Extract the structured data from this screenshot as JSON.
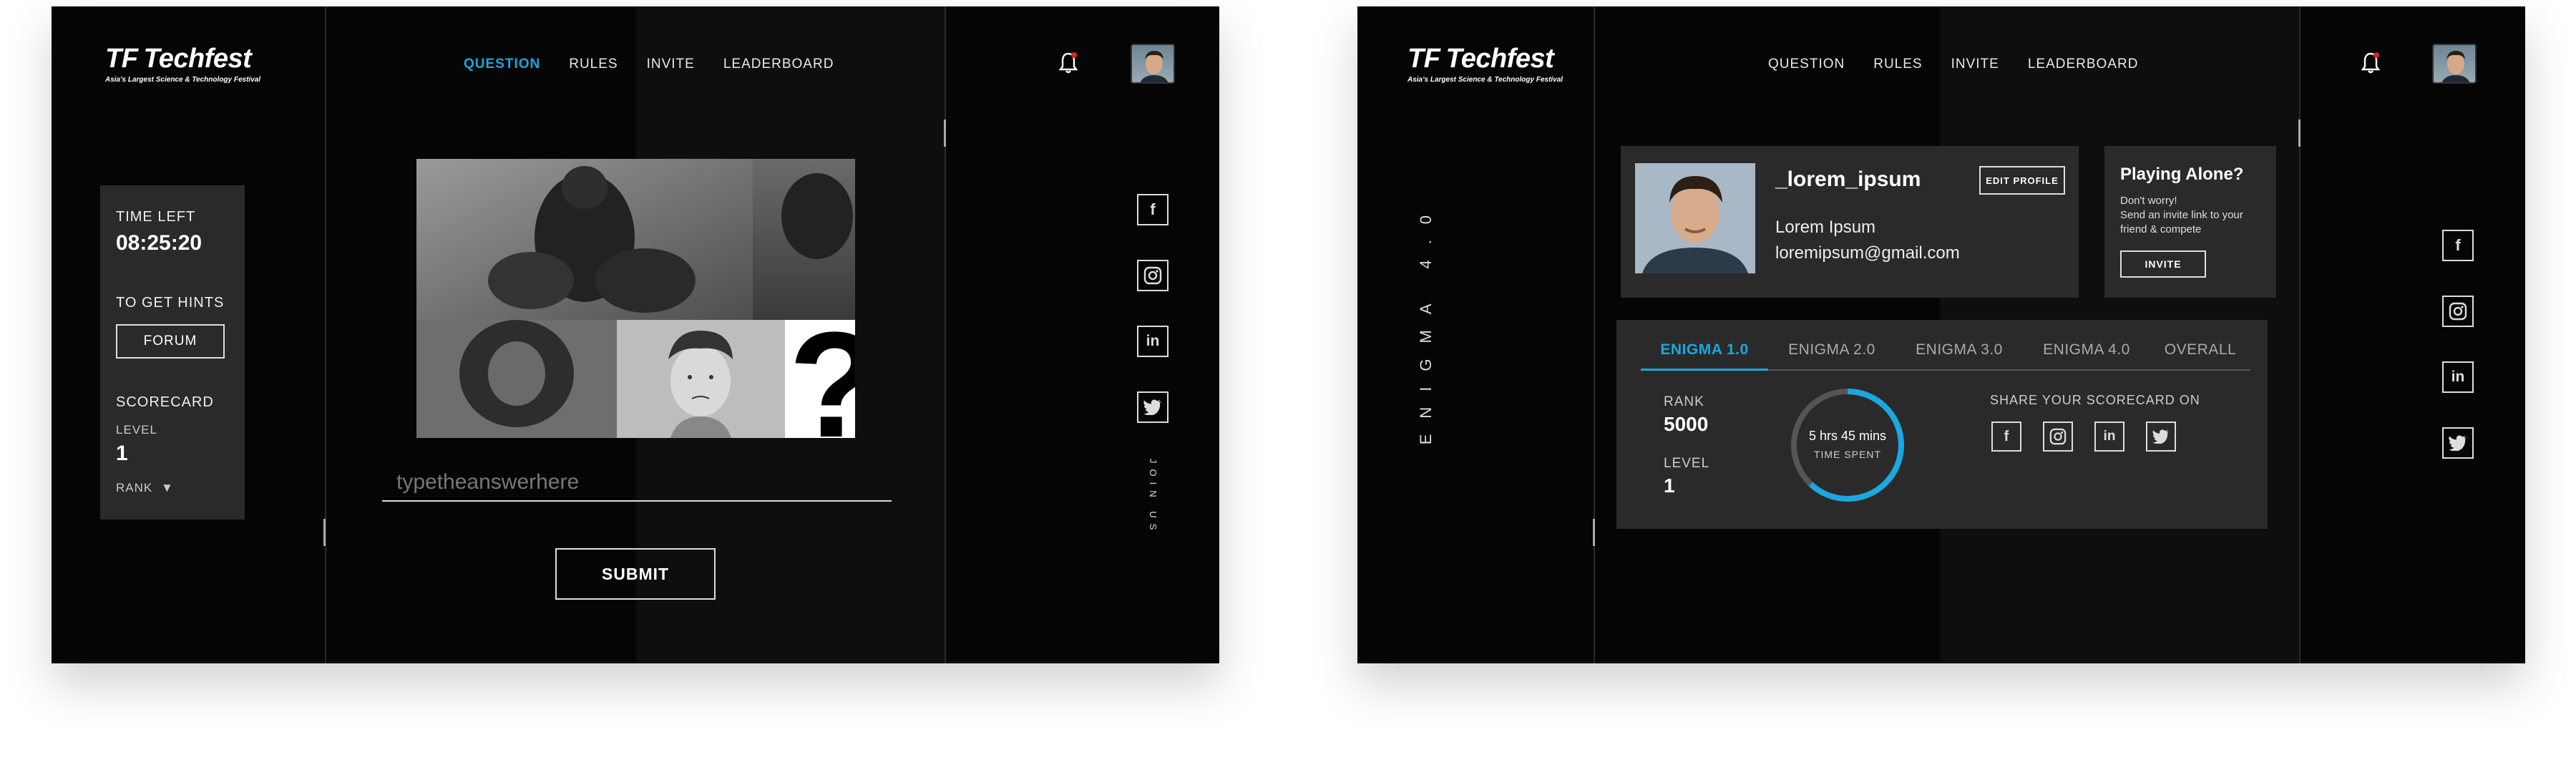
{
  "logo": {
    "brand": "Techfest",
    "mark": "TF",
    "tagline": "Asia's Largest Science & Technology Festival"
  },
  "screen1": {
    "nav": [
      "QUESTION",
      "RULES",
      "INVITE",
      "LEADERBOARD"
    ],
    "active_nav": "QUESTION",
    "time_left_label": "TIME LEFT",
    "time_left_value": "08:25:20",
    "hints_label": "TO GET HINTS",
    "forum_button": "FORUM",
    "scorecard_label": "SCORECARD",
    "level_label": "LEVEL",
    "level_value": "1",
    "rank_label": "RANK",
    "answer_placeholder": "typetheanswerhere",
    "submit_button": "SUBMIT",
    "join_us": "JOIN US"
  },
  "screen2": {
    "nav": [
      "QUESTION",
      "RULES",
      "INVITE",
      "LEADERBOARD"
    ],
    "sidebar_title": "ENIGMA 4.0",
    "profile": {
      "username": "_lorem_ipsum",
      "name": "Lorem Ipsum",
      "email": "loremipsum@gmail.com",
      "edit_button": "EDIT PROFILE"
    },
    "invite_card": {
      "title": "Playing Alone?",
      "line1": "Don't worry!",
      "line2": "Send an invite link to your",
      "line3": "friend & compete",
      "button": "INVITE"
    },
    "tabs": [
      "ENIGMA 1.0",
      "ENIGMA 2.0",
      "ENIGMA 3.0",
      "ENIGMA 4.0",
      "OVERALL"
    ],
    "active_tab": "ENIGMA 1.0",
    "rank_label": "RANK",
    "rank_value": "5000",
    "level_label": "LEVEL",
    "level_value": "1",
    "time_spent_value": "5 hrs 45 mins",
    "time_spent_label": "TIME SPENT",
    "time_spent_fraction": 0.62,
    "share_label": "SHARE YOUR SCORECARD ON"
  },
  "colors": {
    "accent": "#1ba7e0",
    "background": "#050505",
    "panel": "#2a2a2a",
    "bell_dot": "#e02020"
  },
  "icons": [
    "bell-icon",
    "avatar",
    "facebook-icon",
    "instagram-icon",
    "linkedin-icon",
    "twitter-icon",
    "caret-down-icon"
  ]
}
